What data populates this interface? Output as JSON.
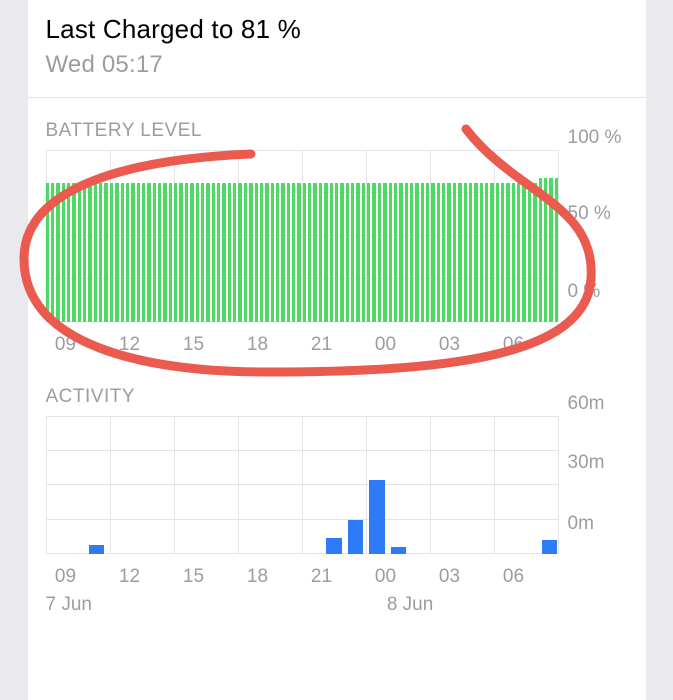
{
  "header": {
    "title": "Last Charged to 81 %",
    "subtitle": "Wed 05:17"
  },
  "battery": {
    "label": "BATTERY LEVEL",
    "y_ticks": [
      "100 %",
      "50 %",
      "0 %"
    ],
    "x_ticks": [
      "09",
      "12",
      "15",
      "18",
      "21",
      "00",
      "03",
      "06"
    ]
  },
  "activity": {
    "label": "ACTIVITY",
    "y_ticks": [
      "60m",
      "30m",
      "0m"
    ],
    "x_ticks": [
      "09",
      "12",
      "15",
      "18",
      "21",
      "00",
      "03",
      "06"
    ],
    "dates": [
      "7 Jun",
      "8 Jun"
    ]
  },
  "chart_data": [
    {
      "type": "bar",
      "title": "BATTERY LEVEL",
      "ylabel": "%",
      "ylim": [
        0,
        100
      ],
      "x": [
        "08",
        "09",
        "10",
        "11",
        "12",
        "13",
        "14",
        "15",
        "16",
        "17",
        "18",
        "19",
        "20",
        "21",
        "22",
        "23",
        "00",
        "01",
        "02",
        "03",
        "04",
        "05",
        "06",
        "07"
      ],
      "values": [
        81,
        81,
        81,
        81,
        81,
        81,
        81,
        81,
        81,
        81,
        81,
        81,
        81,
        81,
        81,
        81,
        81,
        81,
        81,
        81,
        81,
        81,
        81,
        84
      ],
      "x_ticks": [
        "09",
        "12",
        "15",
        "18",
        "21",
        "00",
        "03",
        "06"
      ],
      "y_ticks": [
        0,
        50,
        100
      ]
    },
    {
      "type": "bar",
      "title": "ACTIVITY",
      "ylabel": "minutes",
      "ylim": [
        0,
        60
      ],
      "x": [
        "08",
        "09",
        "10",
        "11",
        "12",
        "13",
        "14",
        "15",
        "16",
        "17",
        "18",
        "19",
        "20",
        "21",
        "22",
        "23",
        "00",
        "01",
        "02",
        "03",
        "04",
        "05",
        "06",
        "07"
      ],
      "values": [
        0,
        0,
        4,
        0,
        0,
        0,
        0,
        0,
        0,
        0,
        0,
        0,
        0,
        7,
        15,
        32,
        3,
        0,
        0,
        0,
        0,
        0,
        0,
        6
      ],
      "x_ticks": [
        "09",
        "12",
        "15",
        "18",
        "21",
        "00",
        "03",
        "06"
      ],
      "y_ticks": [
        0,
        30,
        60
      ],
      "date_labels": {
        "7 Jun": "08",
        "8 Jun": "00"
      }
    }
  ]
}
